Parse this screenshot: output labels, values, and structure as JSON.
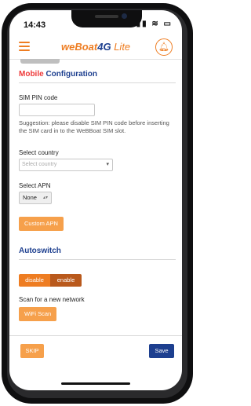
{
  "status": {
    "time": "14:43",
    "icons": "▮▮ ≋ ▭"
  },
  "header": {
    "logo_main": "weBoat",
    "logo_4g": "4G",
    "logo_lite": "Lite"
  },
  "mobile": {
    "title_accent": "Mobile",
    "title_rest": "Configuration",
    "pin_label": "SIM PIN code",
    "pin_value": "",
    "suggestion": "Suggestion: please disable SIM PIN code before inserting the SIM card in to the WeBBoat SIM slot.",
    "country_label": "Select country",
    "country_placeholder": "Select country",
    "apn_label": "Select APN",
    "apn_value": "None",
    "custom_apn": "Custom APN"
  },
  "autoswitch": {
    "title": "Autoswitch",
    "disable": "disable",
    "enable": "enable",
    "scan_label": "Scan for a new network",
    "wifi_scan": "WiFi Scan"
  },
  "footer": {
    "skip": "SKIP",
    "save": "Save"
  },
  "colors": {
    "accent": "#ee7d22",
    "brand": "#1d3f8f",
    "alert": "#ee3a3a"
  }
}
